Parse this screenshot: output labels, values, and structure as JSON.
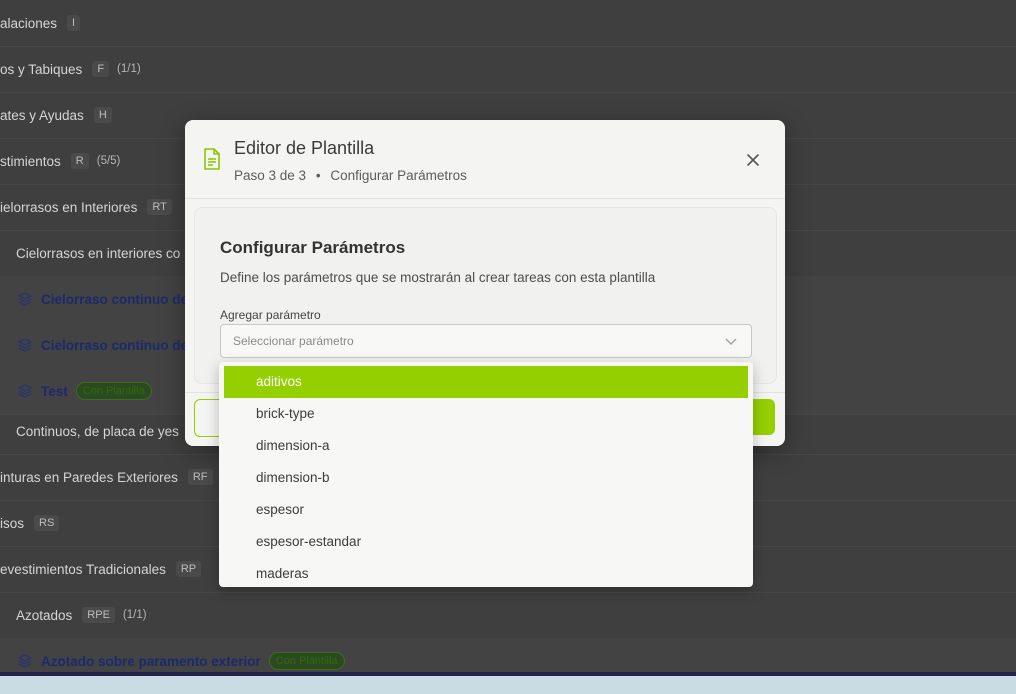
{
  "background": {
    "rows": [
      {
        "label": "alaciones",
        "code": "I",
        "count": ""
      },
      {
        "label": "os y Tabiques",
        "code": "F",
        "count": "(1/1)"
      },
      {
        "label": "ates y Ayudas",
        "code": "H",
        "count": ""
      },
      {
        "label": "stimientos",
        "code": "R",
        "count": "(5/5)"
      },
      {
        "label": "ielorrasos en Interiores",
        "code": "RT",
        "count": ""
      },
      {
        "label": "Cielorrasos en interiores co",
        "code": "",
        "count": ""
      },
      {
        "label": "Cielorraso continuo de",
        "code": "",
        "count": ""
      },
      {
        "label": "Cielorraso continuo de",
        "code": "",
        "count": ""
      },
      {
        "label": "Test",
        "code": "",
        "count": "",
        "badge": "Con Plantilla"
      },
      {
        "label": "Continuos, de placa de yes",
        "code": "",
        "count": ""
      },
      {
        "label": "inturas en Paredes Exteriores",
        "code": "RF",
        "count": ""
      },
      {
        "label": "isos",
        "code": "RS",
        "count": ""
      },
      {
        "label": "evestimientos Tradicionales",
        "code": "RP",
        "count": ""
      },
      {
        "label": "Azotados",
        "code": "RPE",
        "count": "(1/1)"
      },
      {
        "label": "Azotado sobre paramento exterior",
        "code": "",
        "count": "",
        "badge": "Con Plantilla"
      }
    ]
  },
  "modal": {
    "title": "Editor de Plantilla",
    "step": "Paso 3 de 3",
    "separator": "•",
    "step_name": "Configurar Parámetros",
    "section_title": "Configurar Parámetros",
    "section_desc": "Define los parámetros que se mostrarán al crear tareas con esta plantilla",
    "field_label": "Agregar parámetro",
    "select_placeholder": "Seleccionar parámetro"
  },
  "dropdown": {
    "options": [
      "aditivos",
      "brick-type",
      "dimension-a",
      "dimension-b",
      "espesor",
      "espesor-estandar",
      "maderas"
    ],
    "selected_index": 0
  },
  "colors": {
    "accent": "#94cf00",
    "overlay": "#3f3f3f",
    "modal_bg": "#f4f4f2"
  },
  "icons": {
    "modal": "document-icon",
    "close": "close-icon",
    "select": "chevron-down-icon",
    "task": "layers-icon"
  }
}
